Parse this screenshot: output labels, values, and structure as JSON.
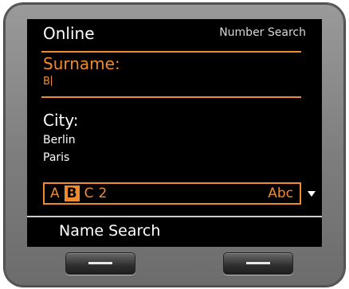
{
  "header": {
    "title": "Online",
    "subtitle": "Number Search"
  },
  "surname": {
    "label": "Surname:",
    "value": "B"
  },
  "city": {
    "label": "City:",
    "items": [
      "Berlin",
      "Paris"
    ]
  },
  "input_bar": {
    "letters": [
      "A",
      "B",
      "C",
      "2"
    ],
    "active_letter": "B",
    "mode": "Abc"
  },
  "softkey": {
    "label": "Name Search"
  },
  "colors": {
    "accent": "#f08a2c",
    "screen_bg": "#000000",
    "text": "#ffffff"
  },
  "icons": [
    "scroll-down-arrow-icon",
    "softkey-dash-icon"
  ]
}
